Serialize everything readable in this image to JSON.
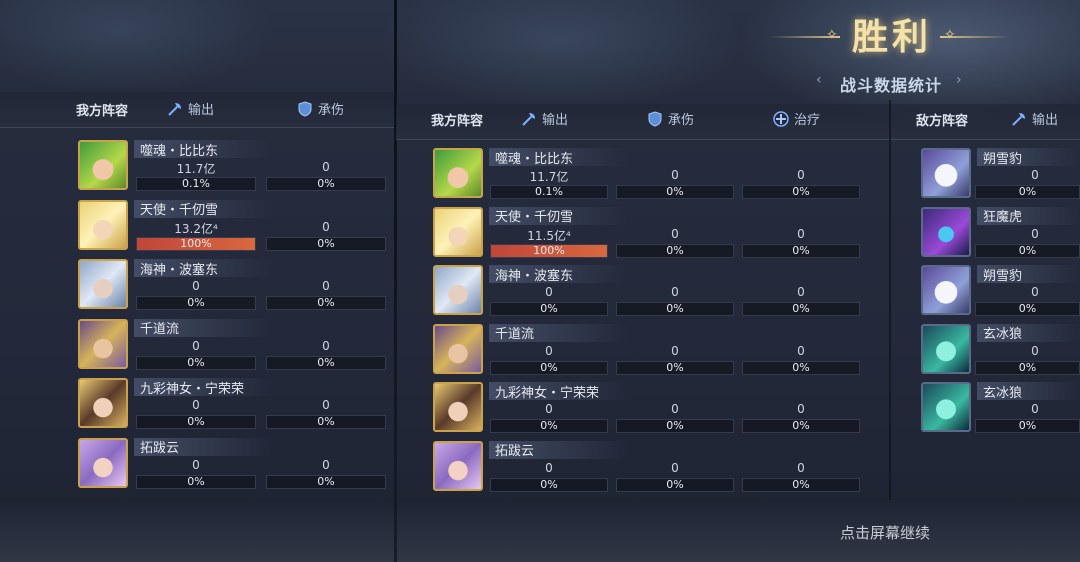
{
  "victory": "胜利",
  "stats_title": "战斗数据统计",
  "continue_hint": "点击屏幕继续",
  "left_panel": {
    "team_label": "我方阵容",
    "tabs": [
      "输出",
      "承伤"
    ],
    "rows": [
      {
        "name": "噬魂・比比东",
        "v1": "11.7亿",
        "p1": "0.1%",
        "fill1": 0.001,
        "v2": "0",
        "p2": "0%",
        "avatar": "green-spiky-hair-hero"
      },
      {
        "name": "天使・千仞雪",
        "v1": "13.2亿⁴",
        "p1": "100%",
        "fill1": 1.0,
        "v2": "0",
        "p2": "0%",
        "avatar": "golden-angel-hero"
      },
      {
        "name": "海神・波塞东",
        "v1": "0",
        "p1": "0%",
        "fill1": 0,
        "v2": "0",
        "p2": "0%",
        "avatar": "silver-sea-god-hero"
      },
      {
        "name": "千道流",
        "v1": "0",
        "p1": "0%",
        "fill1": 0,
        "v2": "0",
        "p2": "0%",
        "avatar": "blonde-elder-hero"
      },
      {
        "name": "九彩神女・宁荣荣",
        "v1": "0",
        "p1": "0%",
        "fill1": 0,
        "v2": "0",
        "p2": "0%",
        "avatar": "dark-hair-goddess-hero"
      },
      {
        "name": "拓跋云",
        "v1": "0",
        "p1": "0%",
        "fill1": 0,
        "v2": "0",
        "p2": "0%",
        "avatar": "lavender-hair-hero"
      }
    ]
  },
  "right_panel": {
    "team_label": "我方阵容",
    "tabs": [
      "输出",
      "承伤",
      "治疗"
    ],
    "rows": [
      {
        "name": "噬魂・比比东",
        "v1": "11.7亿",
        "p1": "0.1%",
        "fill1": 0.001,
        "v2": "0",
        "p2": "0%",
        "v3": "0",
        "p3": "0%",
        "avatar": "green-spiky-hair-hero"
      },
      {
        "name": "天使・千仞雪",
        "v1": "11.5亿⁴",
        "p1": "100%",
        "fill1": 1.0,
        "v2": "0",
        "p2": "0%",
        "v3": "0",
        "p3": "0%",
        "avatar": "golden-angel-hero"
      },
      {
        "name": "海神・波塞东",
        "v1": "0",
        "p1": "0%",
        "fill1": 0,
        "v2": "0",
        "p2": "0%",
        "v3": "0",
        "p3": "0%",
        "avatar": "silver-sea-god-hero"
      },
      {
        "name": "千道流",
        "v1": "0",
        "p1": "0%",
        "fill1": 0,
        "v2": "0",
        "p2": "0%",
        "v3": "0",
        "p3": "0%",
        "avatar": "blonde-elder-hero"
      },
      {
        "name": "九彩神女・宁荣荣",
        "v1": "0",
        "p1": "0%",
        "fill1": 0,
        "v2": "0",
        "p2": "0%",
        "v3": "0",
        "p3": "0%",
        "avatar": "dark-hair-goddess-hero"
      },
      {
        "name": "拓跋云",
        "v1": "0",
        "p1": "0%",
        "fill1": 0,
        "v2": "0",
        "p2": "0%",
        "v3": "0",
        "p3": "0%",
        "avatar": "lavender-hair-hero"
      }
    ],
    "enemy_label": "敌方阵容",
    "enemy_tab": "输出",
    "enemies": [
      {
        "name": "朔雪豹",
        "v1": "0",
        "p1": "0%",
        "avatar": "white-snow-leopard"
      },
      {
        "name": "狂魔虎",
        "v1": "0",
        "p1": "0%",
        "avatar": "purple-demon-tiger"
      },
      {
        "name": "朔雪豹",
        "v1": "0",
        "p1": "0%",
        "avatar": "white-snow-leopard"
      },
      {
        "name": "玄冰狼",
        "v1": "0",
        "p1": "0%",
        "avatar": "teal-ice-wolf"
      },
      {
        "name": "玄冰狼",
        "v1": "0",
        "p1": "0%",
        "avatar": "teal-ice-wolf"
      }
    ]
  },
  "colors": {
    "accent_gold": "#c9a24a",
    "bar_fill": "#d7683e",
    "title_gold": "#f4e2a8"
  }
}
